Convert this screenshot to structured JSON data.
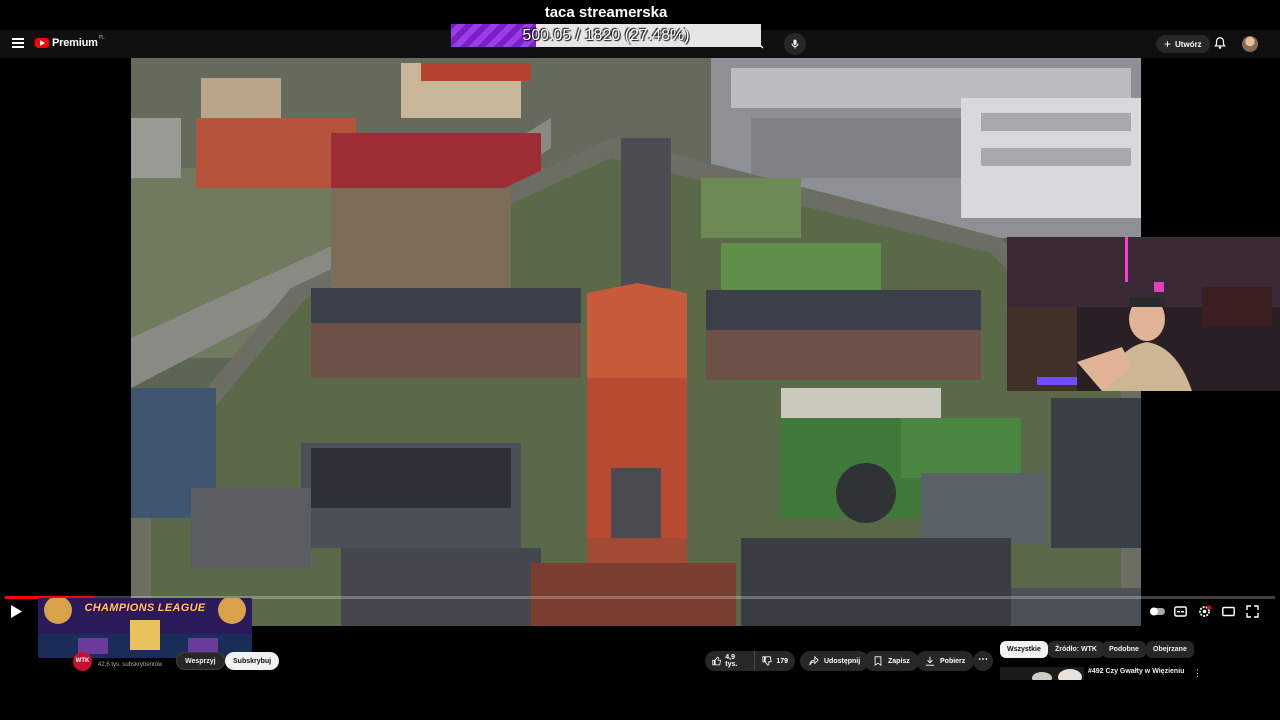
{
  "overlay": {
    "title": "taca streamerska",
    "progress_text": "500.05 / 1820 (27.48%)",
    "progress_fraction": 0.2748,
    "bar_color": "#8a2be2"
  },
  "header": {
    "logo_text": "Premium",
    "logo_region": "PL",
    "create_label": "Utwórz",
    "icons": [
      "menu-icon",
      "search-icon",
      "mic-icon",
      "plus-icon",
      "bell-icon"
    ]
  },
  "player": {
    "played_fraction": 0.07,
    "accent_color": "#ff0000",
    "controls": [
      "play-icon",
      "autoplay-toggle",
      "subtitles-icon",
      "settings-icon",
      "theater-icon",
      "fullscreen-icon"
    ]
  },
  "channel": {
    "avatar_text": "WTK",
    "subscribers": "42,6 tys. subskrybentów",
    "join_label": "Wesprzyj",
    "subscribe_label": "Subskrybuj"
  },
  "thumbnail": {
    "title": "CHAMPIONS LEAGUE"
  },
  "actions": {
    "likes": "4,9 tys.",
    "dislikes": "179",
    "share": "Udostępnij",
    "save": "Zapisz",
    "download": "Pobierz",
    "more": "⋯"
  },
  "chips": [
    "Wszystkie",
    "Źródło: WTK",
    "Podobne",
    "Obejrzane"
  ],
  "recommendation": {
    "title": "#492 Czy Gwałty w Więzieniu",
    "menu": "⋮"
  }
}
